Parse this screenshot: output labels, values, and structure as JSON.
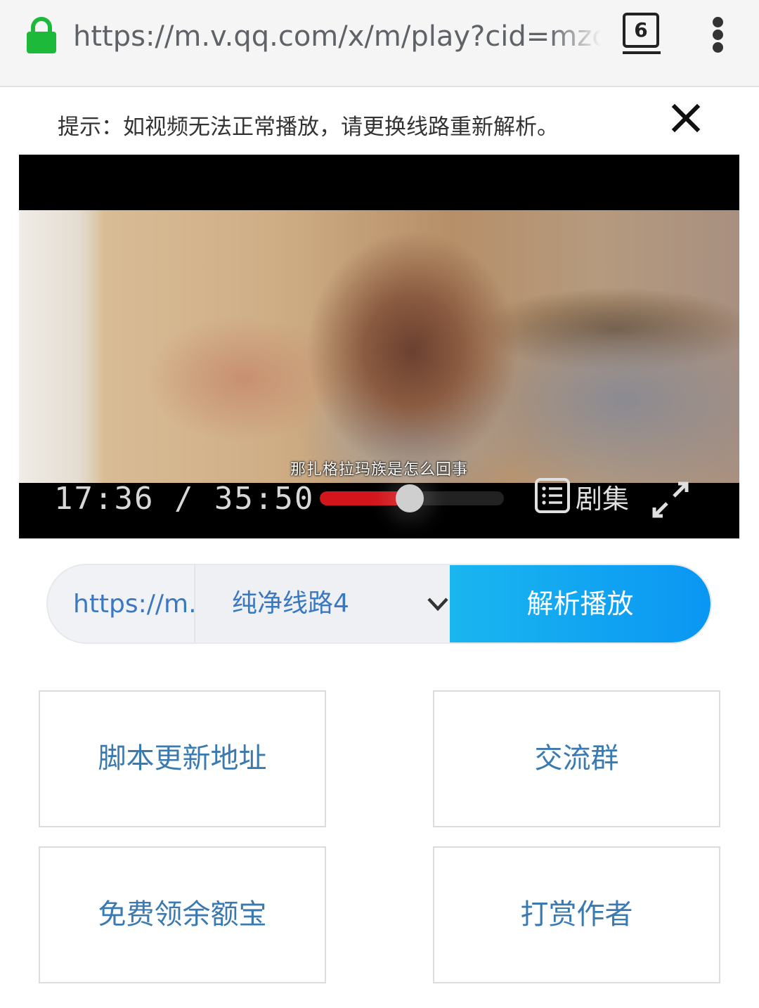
{
  "browser": {
    "url": "https://m.v.qq.com/x/m/play?cid=mzc",
    "tab_count": "6",
    "secure_color": "#1db93b"
  },
  "notice": {
    "text": "提示：如视频无法正常播放，请更换线路重新解析。"
  },
  "player": {
    "subtitle": "那扎格拉玛族是怎么回事",
    "time_display": "17:36 / 35:50",
    "current_time": "17:36",
    "duration": "35:50",
    "progress_fraction": 0.49,
    "episodes_label": "剧集",
    "progress_color": "#d2161c"
  },
  "parse_bar": {
    "url_value": "https://m.v.qq.com/x/m/play?cid=mzc",
    "route_selected": "纯净线路4",
    "parse_button_label": "解析播放",
    "accent_color": "#0a96f3"
  },
  "actions": [
    {
      "label": "脚本更新地址"
    },
    {
      "label": "交流群"
    },
    {
      "label": "免费领余额宝"
    },
    {
      "label": "打赏作者"
    }
  ],
  "icons": {
    "lock": "lock-icon",
    "menu": "more-vert-icon",
    "close": "close-icon",
    "playlist": "playlist-icon",
    "fullscreen": "fullscreen-icon",
    "dropdown": "chevron-down-icon"
  }
}
